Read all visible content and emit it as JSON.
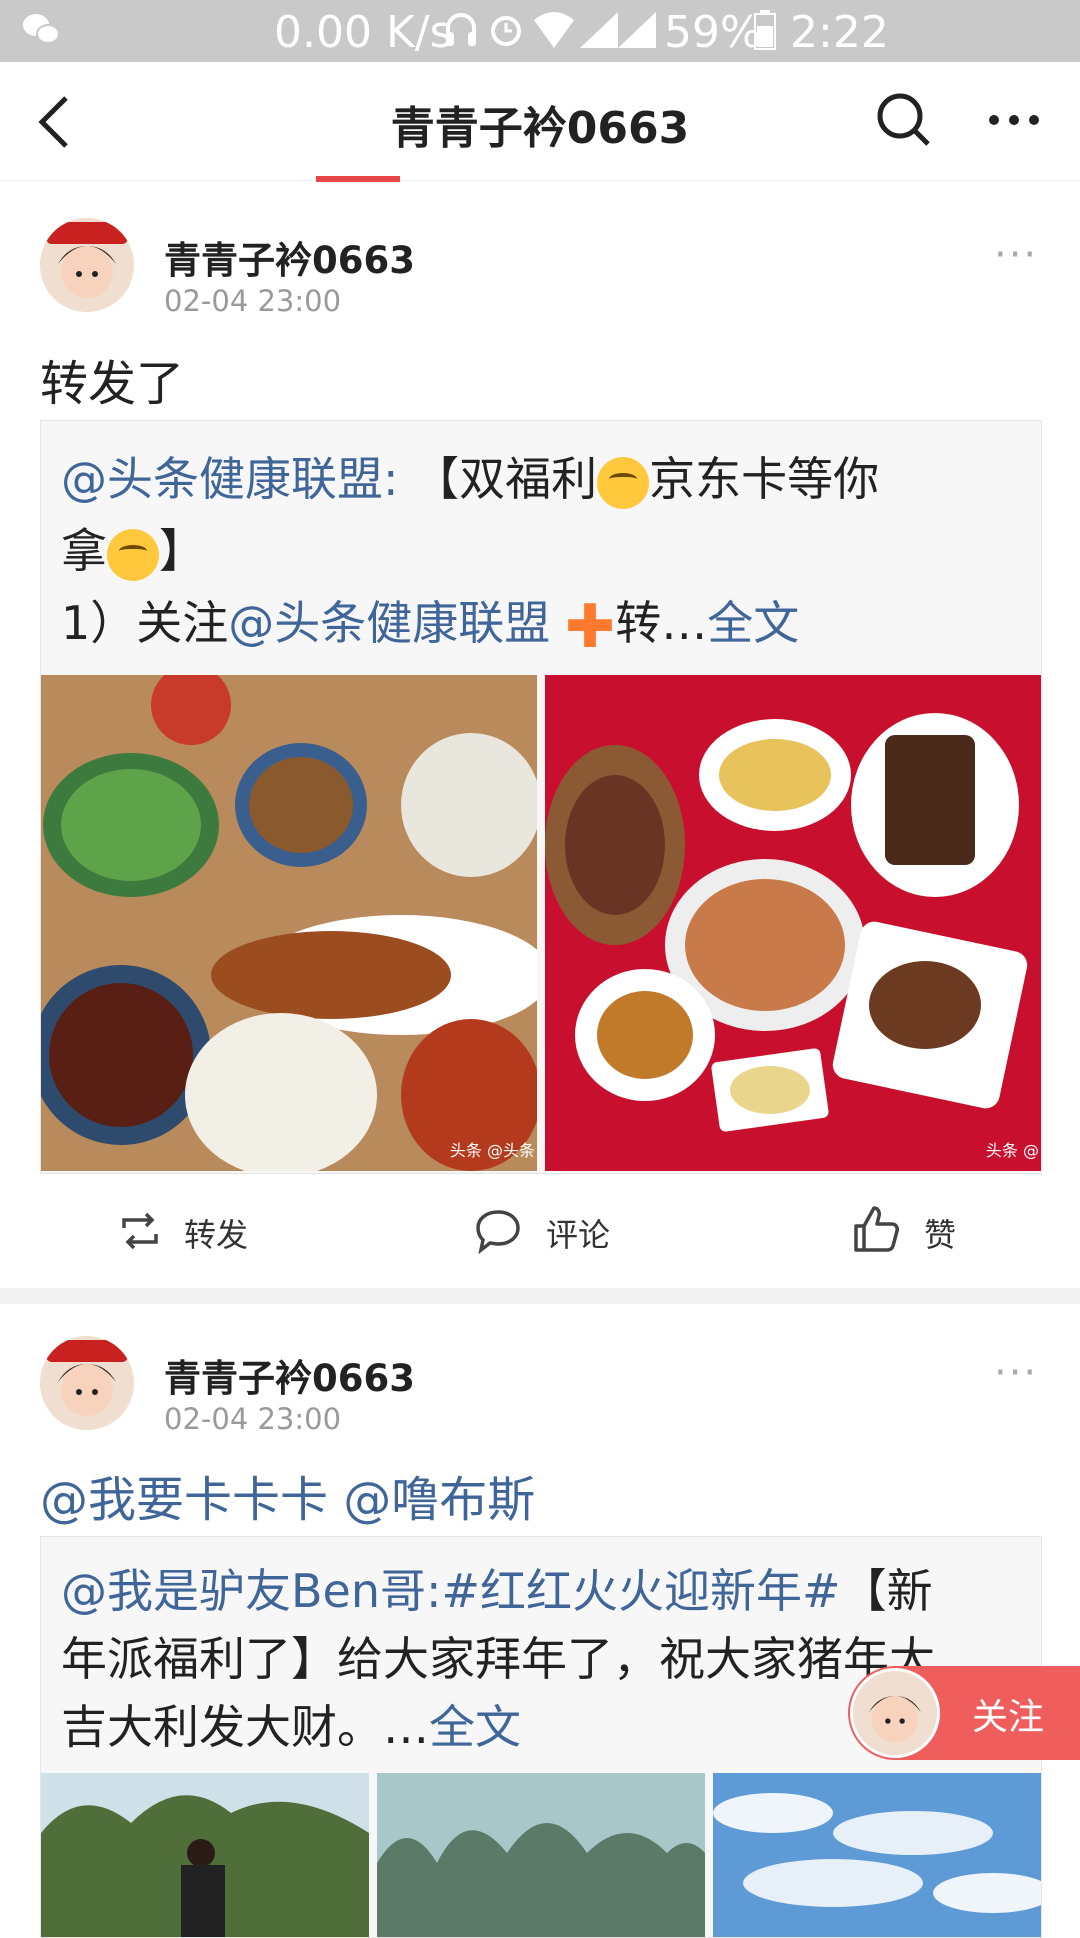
{
  "status_bar": {
    "network_speed": "0.00 K/s",
    "battery": "59%",
    "time": "2:22",
    "icons": [
      "wechat-icon",
      "headphones-icon",
      "alarm-icon",
      "wifi-icon",
      "signal-icon",
      "signal-icon",
      "battery-icon"
    ]
  },
  "nav": {
    "title": "青青子衿0663",
    "back_icon": "chevron-left-icon",
    "search_icon": "search-icon",
    "more_icon": "more-horizontal-icon"
  },
  "posts": [
    {
      "username": "青青子衿0663",
      "time": "02-04 23:00",
      "text": "转发了",
      "quote": {
        "mention": "@头条健康联盟:",
        "text1": "【双福利",
        "text2": "京东卡等你",
        "text3": "拿",
        "text4": "】",
        "line3_prefix": "1）关注",
        "line3_mention": "@头条健康联盟",
        "line3_suffix": "转…",
        "more_link": "全文"
      },
      "images": [
        {
          "watermark": "头条 @头条"
        },
        {
          "watermark": "头条 @"
        }
      ],
      "actions": {
        "repost": "转发",
        "comment": "评论",
        "like": "赞"
      }
    },
    {
      "username": "青青子衿0663",
      "time": "02-04 23:00",
      "mentions": "@我要卡卡卡 @噜布斯",
      "quote": {
        "mention": "@我是驴友Ben哥:",
        "hashtag": "#红红火火迎新年#",
        "line1_suffix": "【新",
        "line2": "年派福利了】给大家拜年了，祝大家猪年大",
        "line3": "吉大利发大财。…",
        "more_link": "全文"
      }
    }
  ],
  "follow_button": {
    "label": "关注"
  },
  "colors": {
    "link": "#406599",
    "accent": "#e8474a",
    "follow_bg": "#ef5d5d"
  }
}
